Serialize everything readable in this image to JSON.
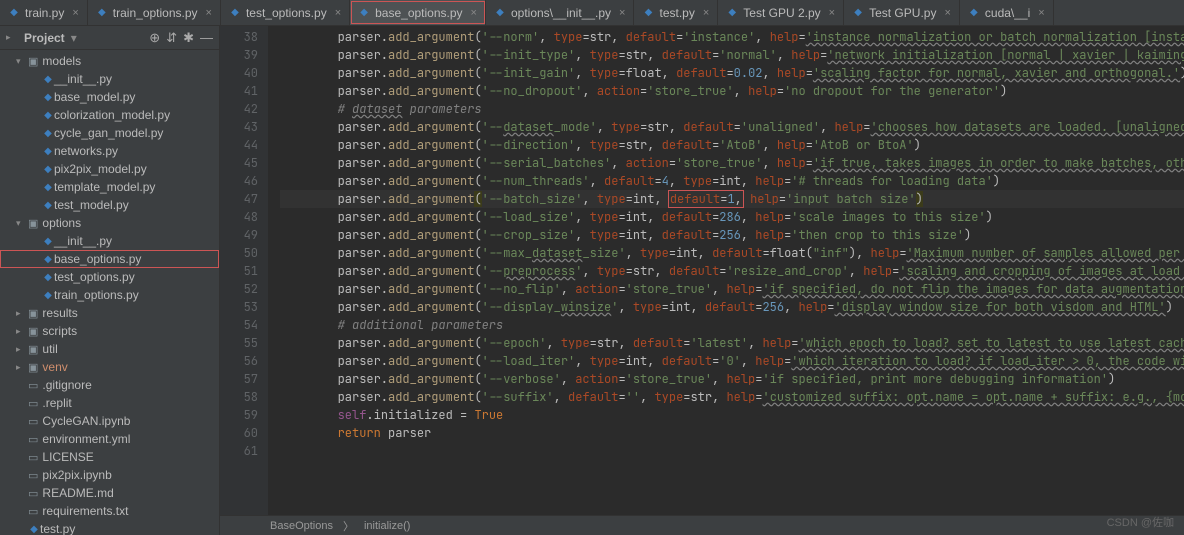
{
  "sidebar": {
    "title": "Project",
    "icons": {
      "collapse": "⇤",
      "target": "⊕",
      "gear": "✱",
      "hide": "—"
    },
    "tree": [
      {
        "label": "models",
        "depth": 1,
        "type": "folder",
        "expanded": true
      },
      {
        "label": "__init__.py",
        "depth": 2,
        "type": "py"
      },
      {
        "label": "base_model.py",
        "depth": 2,
        "type": "py"
      },
      {
        "label": "colorization_model.py",
        "depth": 2,
        "type": "py"
      },
      {
        "label": "cycle_gan_model.py",
        "depth": 2,
        "type": "py"
      },
      {
        "label": "networks.py",
        "depth": 2,
        "type": "py"
      },
      {
        "label": "pix2pix_model.py",
        "depth": 2,
        "type": "py"
      },
      {
        "label": "template_model.py",
        "depth": 2,
        "type": "py"
      },
      {
        "label": "test_model.py",
        "depth": 2,
        "type": "py"
      },
      {
        "label": "options",
        "depth": 1,
        "type": "folder",
        "expanded": true
      },
      {
        "label": "__init__.py",
        "depth": 2,
        "type": "py"
      },
      {
        "label": "base_options.py",
        "depth": 2,
        "type": "py",
        "highlighted": true
      },
      {
        "label": "test_options.py",
        "depth": 2,
        "type": "py"
      },
      {
        "label": "train_options.py",
        "depth": 2,
        "type": "py"
      },
      {
        "label": "results",
        "depth": 1,
        "type": "folder",
        "expanded": false
      },
      {
        "label": "scripts",
        "depth": 1,
        "type": "folder",
        "expanded": false
      },
      {
        "label": "util",
        "depth": 1,
        "type": "folder",
        "expanded": false
      },
      {
        "label": "venv",
        "depth": 1,
        "type": "folder",
        "expanded": false,
        "venv": true
      },
      {
        "label": ".gitignore",
        "depth": 1,
        "type": "file"
      },
      {
        "label": ".replit",
        "depth": 1,
        "type": "file"
      },
      {
        "label": "CycleGAN.ipynb",
        "depth": 1,
        "type": "file"
      },
      {
        "label": "environment.yml",
        "depth": 1,
        "type": "file"
      },
      {
        "label": "LICENSE",
        "depth": 1,
        "type": "file"
      },
      {
        "label": "pix2pix.ipynb",
        "depth": 1,
        "type": "file"
      },
      {
        "label": "README.md",
        "depth": 1,
        "type": "file"
      },
      {
        "label": "requirements.txt",
        "depth": 1,
        "type": "file"
      },
      {
        "label": "test.py",
        "depth": 1,
        "type": "py"
      }
    ]
  },
  "tabs": [
    {
      "label": "train.py",
      "icon": "py"
    },
    {
      "label": "train_options.py",
      "icon": "py"
    },
    {
      "label": "test_options.py",
      "icon": "py"
    },
    {
      "label": "base_options.py",
      "icon": "py",
      "active": true,
      "highlighted": true
    },
    {
      "label": "options\\__init__.py",
      "icon": "py"
    },
    {
      "label": "test.py",
      "icon": "py"
    },
    {
      "label": "Test GPU 2.py",
      "icon": "py"
    },
    {
      "label": "Test GPU.py",
      "icon": "py"
    },
    {
      "label": "cuda\\__i",
      "icon": "py"
    }
  ],
  "editor": {
    "first_line_no": 38,
    "current_line_no": 47,
    "lines": [
      {
        "html": "        parser.<span class='s-fn'>add_argument</span>(<span class='s-st'>'--norm'</span>, <span class='s-pn'>type</span>=str, <span class='s-pn'>default</span>=<span class='s-st'>'instance'</span>, <span class='s-pn'>help</span>=<span class='s-st s-un'>'instance normalization or batch normalization [insta</span>"
      },
      {
        "html": "        parser.<span class='s-fn'>add_argument</span>(<span class='s-st'>'--init_type'</span>, <span class='s-pn'>type</span>=str, <span class='s-pn'>default</span>=<span class='s-st'>'normal'</span>, <span class='s-pn'>help</span>=<span class='s-st s-un'>'network initialization [normal | xavier | kaiming</span>"
      },
      {
        "html": "        parser.<span class='s-fn'>add_argument</span>(<span class='s-st'>'--init_gain'</span>, <span class='s-pn'>type</span>=float, <span class='s-pn'>default</span>=<span class='s-nm'>0.02</span>, <span class='s-pn'>help</span>=<span class='s-st s-un'>'scaling factor for normal, xavier and orthogonal.'</span>)"
      },
      {
        "html": "        parser.<span class='s-fn'>add_argument</span>(<span class='s-st'>'--no_dropout'</span>, <span class='s-pn'>action</span>=<span class='s-st'>'store_true'</span>, <span class='s-pn'>help</span>=<span class='s-st'>'no dropout for the generator'</span>)"
      },
      {
        "html": "        <span class='s-cm'># <span class='s-un'>dataset</span> parameters</span>"
      },
      {
        "html": "        parser.<span class='s-fn'>add_argument</span>(<span class='s-st'>'--<span class='s-un'>dataset</span>_mode'</span>, <span class='s-pn'>type</span>=str, <span class='s-pn'>default</span>=<span class='s-st'>'unaligned'</span>, <span class='s-pn'>help</span>=<span class='s-st s-un'>'chooses how datasets are loaded. [unaligned</span>"
      },
      {
        "html": "        parser.<span class='s-fn'>add_argument</span>(<span class='s-st'>'--direction'</span>, <span class='s-pn'>type</span>=str, <span class='s-pn'>default</span>=<span class='s-st'>'AtoB'</span>, <span class='s-pn'>help</span>=<span class='s-st'>'AtoB or BtoA'</span>)"
      },
      {
        "html": "        parser.<span class='s-fn'>add_argument</span>(<span class='s-st'>'--serial_batches'</span>, <span class='s-pn'>action</span>=<span class='s-st'>'store_true'</span>, <span class='s-pn'>help</span>=<span class='s-st s-un'>'if true, takes images in order to make batches, oth</span>"
      },
      {
        "html": "        parser.<span class='s-fn'>add_argument</span>(<span class='s-st'>'--num_threads'</span>, <span class='s-pn'>default</span>=<span class='s-nm'>4</span>, <span class='s-pn'>type</span>=int, <span class='s-pn'>help</span>=<span class='s-st'>'# threads for loading data'</span>)"
      },
      {
        "html": "        parser.<span class='s-fn'>add_argument</span><span class='s-h1'>(</span><span class='s-st'>'--batch_size'</span>, <span class='s-pn'>type</span>=int, <span class='hl-box'><span class='s-pn'>default</span>=<span class='s-nm'>1</span>,</span> <span class='s-pn'>help</span>=<span class='s-st'>'input batch size'</span><span class='s-h1'>)</span>",
        "current": true
      },
      {
        "html": "        parser.<span class='s-fn'>add_argument</span>(<span class='s-st'>'--load_size'</span>, <span class='s-pn'>type</span>=int, <span class='s-pn'>default</span>=<span class='s-nm'>286</span>, <span class='s-pn'>help</span>=<span class='s-st'>'scale images to this size'</span>)"
      },
      {
        "html": "        parser.<span class='s-fn'>add_argument</span>(<span class='s-st'>'--crop_size'</span>, <span class='s-pn'>type</span>=int, <span class='s-pn'>default</span>=<span class='s-nm'>256</span>, <span class='s-pn'>help</span>=<span class='s-st'>'then crop to this size'</span>)"
      },
      {
        "html": "        parser.<span class='s-fn'>add_argument</span>(<span class='s-st'>'--max_<span class='s-un'>dataset</span>_size'</span>, <span class='s-pn'>type</span>=int, <span class='s-pn'>default</span>=float(<span class='s-st'>\"inf\"</span>), <span class='s-pn'>help</span>=<span class='s-st s-un'>'Maximum number of samples allowed per </span>"
      },
      {
        "html": "        parser.<span class='s-fn'>add_argument</span>(<span class='s-st'>'--<span class='s-un'>preprocess</span>'</span>, <span class='s-pn'>type</span>=str, <span class='s-pn'>default</span>=<span class='s-st'>'resize_and_crop'</span>, <span class='s-pn'>help</span>=<span class='s-st s-un'>'scaling and cropping of images at load </span>"
      },
      {
        "html": "        parser.<span class='s-fn'>add_argument</span>(<span class='s-st'>'--no_flip'</span>, <span class='s-pn'>action</span>=<span class='s-st'>'store_true'</span>, <span class='s-pn'>help</span>=<span class='s-st s-un'>'if specified, do not flip the images for data augmentation</span>"
      },
      {
        "html": "        parser.<span class='s-fn'>add_argument</span>(<span class='s-st'>'--display_<span class='s-un'>winsize</span>'</span>, <span class='s-pn'>type</span>=int, <span class='s-pn'>default</span>=<span class='s-nm'>256</span>, <span class='s-pn'>help</span>=<span class='s-st s-un'>'display window size for both visdom and HTML'</span>)"
      },
      {
        "html": "        <span class='s-cm'># additional parameters</span>"
      },
      {
        "html": "        parser.<span class='s-fn'>add_argument</span>(<span class='s-st'>'--epoch'</span>, <span class='s-pn'>type</span>=str, <span class='s-pn'>default</span>=<span class='s-st'>'latest'</span>, <span class='s-pn'>help</span>=<span class='s-st s-un'>'which epoch to load? set to latest to use latest cach</span>"
      },
      {
        "html": "        parser.<span class='s-fn'>add_argument</span>(<span class='s-st'>'--load_iter'</span>, <span class='s-pn'>type</span>=int, <span class='s-pn'>default</span>=<span class='s-st'>'0'</span>, <span class='s-pn'>help</span>=<span class='s-st s-un'>'which iteration to load? if load_iter &gt; 0, the code wi</span>"
      },
      {
        "html": "        parser.<span class='s-fn'>add_argument</span>(<span class='s-st'>'--verbose'</span>, <span class='s-pn'>action</span>=<span class='s-st'>'store_true'</span>, <span class='s-pn'>help</span>=<span class='s-st'>'if specified, print more debugging information'</span>)"
      },
      {
        "html": "        parser.<span class='s-fn'>add_argument</span>(<span class='s-st'>'--suffix'</span>, <span class='s-pn'>default</span>=<span class='s-st'>''</span>, <span class='s-pn'>type</span>=str, <span class='s-pn'>help</span>=<span class='s-st s-un'>'customized suffix: opt.name = opt.name + suffix: e.g., {mo</span>"
      },
      {
        "html": "        <span class='s-sf'>self</span>.initialized = <span class='s-kw'>True</span>"
      },
      {
        "html": "        <span class='s-kw'>return</span> parser"
      },
      {
        "html": ""
      }
    ]
  },
  "breadcrumb": [
    "BaseOptions",
    "initialize()"
  ],
  "watermark": "CSDN @佐咖"
}
